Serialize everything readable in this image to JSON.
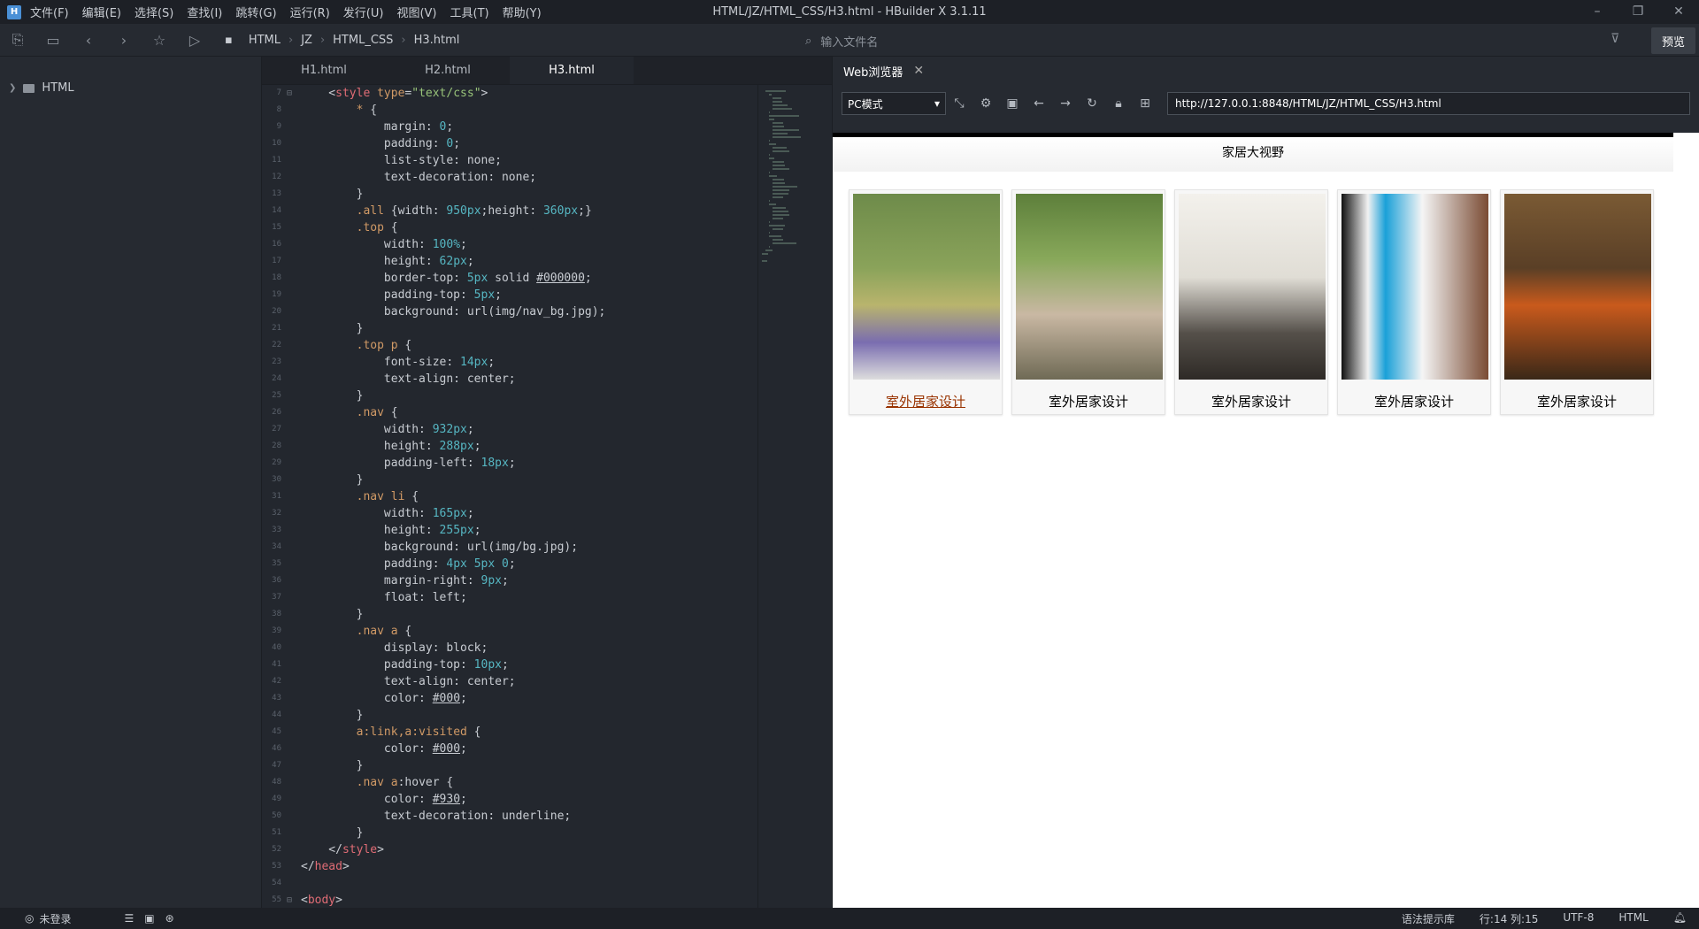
{
  "window": {
    "title": "HTML/JZ/HTML_CSS/H3.html - HBuilder X 3.1.11",
    "controls": [
      "–",
      "❐",
      "✕"
    ]
  },
  "menu": [
    "文件(F)",
    "编辑(E)",
    "选择(S)",
    "查找(I)",
    "跳转(G)",
    "运行(R)",
    "发行(U)",
    "视图(V)",
    "工具(T)",
    "帮助(Y)"
  ],
  "breadcrumb": [
    "HTML",
    "JZ",
    "HTML_CSS",
    "H3.html"
  ],
  "toolbar": {
    "file_placeholder": "输入文件名",
    "preview_label": "预览"
  },
  "sidebar": {
    "root": "HTML"
  },
  "tabs": [
    "H1.html",
    "H2.html",
    "H3.html"
  ],
  "code": [
    {
      "n": "7",
      "f": "⊟",
      "t": "    <style type=\"text/css\">"
    },
    {
      "n": "8",
      "t": "        * {"
    },
    {
      "n": "9",
      "t": "            margin: 0;"
    },
    {
      "n": "10",
      "t": "            padding: 0;"
    },
    {
      "n": "11",
      "t": "            list-style: none;"
    },
    {
      "n": "12",
      "t": "            text-decoration: none;"
    },
    {
      "n": "13",
      "t": "        }"
    },
    {
      "n": "14",
      "t": "        .all {width: 950px;height: 360px;}"
    },
    {
      "n": "15",
      "t": "        .top {"
    },
    {
      "n": "16",
      "t": "            width: 100%;"
    },
    {
      "n": "17",
      "t": "            height: 62px;"
    },
    {
      "n": "18",
      "t": "            border-top: 5px solid #000000;"
    },
    {
      "n": "19",
      "t": "            padding-top: 5px;"
    },
    {
      "n": "20",
      "t": "            background: url(img/nav_bg.jpg);"
    },
    {
      "n": "21",
      "t": "        }"
    },
    {
      "n": "22",
      "t": "        .top p {"
    },
    {
      "n": "23",
      "t": "            font-size: 14px;"
    },
    {
      "n": "24",
      "t": "            text-align: center;"
    },
    {
      "n": "25",
      "t": "        }"
    },
    {
      "n": "26",
      "t": "        .nav {"
    },
    {
      "n": "27",
      "t": "            width: 932px;"
    },
    {
      "n": "28",
      "t": "            height: 288px;"
    },
    {
      "n": "29",
      "t": "            padding-left: 18px;"
    },
    {
      "n": "30",
      "t": "        }"
    },
    {
      "n": "31",
      "t": "        .nav li {"
    },
    {
      "n": "32",
      "t": "            width: 165px;"
    },
    {
      "n": "33",
      "t": "            height: 255px;"
    },
    {
      "n": "34",
      "t": "            background: url(img/bg.jpg);"
    },
    {
      "n": "35",
      "t": "            padding: 4px 5px 0;"
    },
    {
      "n": "36",
      "t": "            margin-right: 9px;"
    },
    {
      "n": "37",
      "t": "            float: left;"
    },
    {
      "n": "38",
      "t": "        }"
    },
    {
      "n": "39",
      "t": "        .nav a {"
    },
    {
      "n": "40",
      "t": "            display: block;"
    },
    {
      "n": "41",
      "t": "            padding-top: 10px;"
    },
    {
      "n": "42",
      "t": "            text-align: center;"
    },
    {
      "n": "43",
      "t": "            color: #000;"
    },
    {
      "n": "44",
      "t": "        }"
    },
    {
      "n": "45",
      "t": "        a:link,a:visited {"
    },
    {
      "n": "46",
      "t": "            color: #000;"
    },
    {
      "n": "47",
      "t": "        }"
    },
    {
      "n": "48",
      "t": "        .nav a:hover {"
    },
    {
      "n": "49",
      "t": "            color: #930;"
    },
    {
      "n": "50",
      "t": "            text-decoration: underline;"
    },
    {
      "n": "51",
      "t": "        }"
    },
    {
      "n": "52",
      "t": "    </style>"
    },
    {
      "n": "53",
      "t": "</head>"
    },
    {
      "n": "54",
      "t": ""
    },
    {
      "n": "55",
      "f": "⊟",
      "t": "<body>"
    }
  ],
  "browser": {
    "tab_label": "Web浏览器",
    "mode": "PC模式",
    "url": "http://127.0.0.1:8848/HTML/JZ/HTML_CSS/H3.html"
  },
  "page": {
    "heading": "家居大视野",
    "items": [
      "室外居家设计",
      "室外居家设计",
      "室外居家设计",
      "室外居家设计",
      "室外居家设计"
    ]
  },
  "status": {
    "login": "未登录",
    "syntax": "语法提示库",
    "position": "行:14  列:15",
    "encoding": "UTF-8",
    "lang": "HTML"
  },
  "colors": {
    "accent": "#4a90d6",
    "hover_link": "#993300"
  }
}
